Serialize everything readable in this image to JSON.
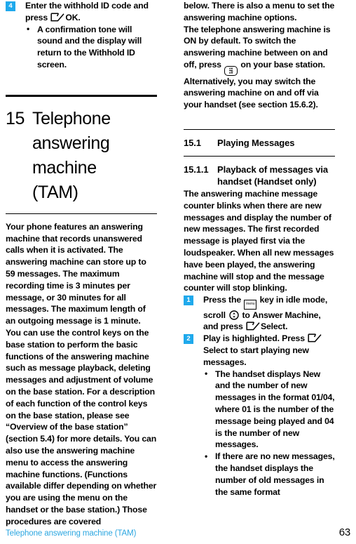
{
  "footer": {
    "title": "Telephone answering machine (TAM)",
    "page": "63"
  },
  "colors": {
    "badge_blue": "#1fa9ec",
    "footer_blue": "#2ba6e0"
  },
  "icons": {
    "softkey": "softkey-icon",
    "onoff": "onoff-key-icon",
    "onoff_label_top": "on",
    "onoff_label_bottom": "off",
    "menu": "menu-key-icon",
    "menu_label": "menu",
    "scroll": "scroll-navigation-icon"
  },
  "left_column": {
    "step4": {
      "number": "4",
      "line1": "Enter the withhold ID code and",
      "line2_pre": "press",
      "line2_post": "OK",
      "line2_end": ".",
      "bullet": {
        "text_pre": "A confirmation tone will sound and the display will return to the ",
        "bold": "Withhold ID",
        "text_post": " screen."
      }
    },
    "chapter": {
      "number": "15",
      "title_line1": "Telephone",
      "title_line2": "answering machine",
      "title_line3": "(TAM)"
    },
    "intro_paragraph": "Your phone features an answering machine that records unanswered calls when it is activated. The answering machine can store up to 59 messages. The maximum recording time is 3 minutes per message, or 30 minutes for all messages. The maximum length of an outgoing message is 1 minute. You can use the control keys on the base station to perform the basic functions of the answering machine such as message playback, deleting messages and adjustment of volume on the base station. For a description of each function of the control keys on the base station, please see “Overview of the base station” (section 5.4) for more details. You can also use the answering machine menu to access the answering machine functions. (Functions available differ depending on whether you are using the menu on the handset or the base station.) Those procedures are covered"
  },
  "right_column": {
    "para1": "below. There is also a menu to set the answering machine options.",
    "para2_a": "The telephone answering machine is ON by default. To switch the answering machine between on and off, press",
    "para2_b": "on your base station. Alternatively, you may switch the answering machine on and off via your handset (see section 15.6.2).",
    "heading_15_1": {
      "number": "15.1",
      "title": "Playing Messages"
    },
    "heading_15_1_1": {
      "number": "15.1.1",
      "title_line1": "Playback of messages via",
      "title_line2": "handset (Handset only)"
    },
    "para3": "The answering machine message counter blinks when there are new messages and display the number of new messages. The first recorded message is played first via the loudspeaker. When all new messages have been played, the answering machine will stop and the message counter will stop blinking.",
    "step1": {
      "number": "1",
      "part1": "Press the",
      "part2": "key in idle mode, scroll",
      "part3": "to",
      "bold1": "Answer Machine",
      "part4": ", and press",
      "bold2": "Select",
      "part5": "."
    },
    "step2": {
      "number": "2",
      "bold1": "Play",
      "part1": "is highlighted. Press",
      "bold2": "Select",
      "part2": "to start playing new messages."
    },
    "bullet1": {
      "pre": "The handset displays ",
      "b1": "New",
      "mid1": " and the number of new messages in the format ",
      "b2": "01/04",
      "mid2": ", where ",
      "b3": "01",
      "mid3": " is the number of the message being played and ",
      "b4": "04",
      "post": " is the number of new messages."
    },
    "bullet2": {
      "text": "If there are no new messages, the handset displays the number of old messages in the same format"
    }
  }
}
